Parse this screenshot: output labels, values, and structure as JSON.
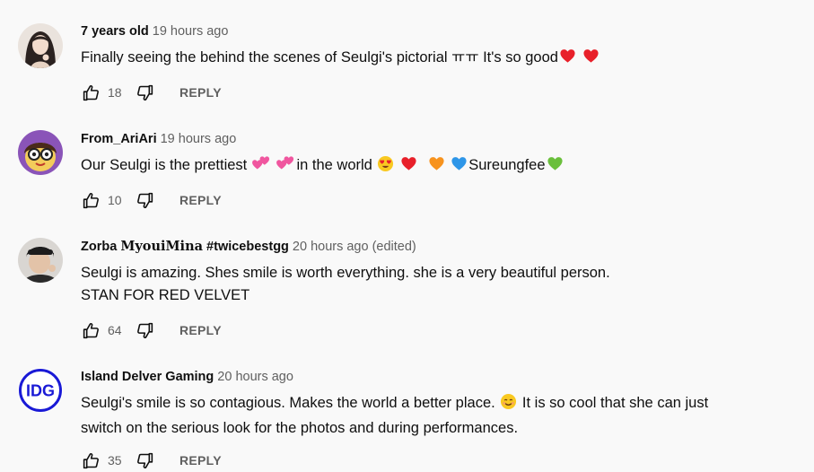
{
  "comments": [
    {
      "author": "7 years old",
      "time": "19 hours ago",
      "text_lines": [
        "Finally seeing the behind the scenes of Seulgi's pictorial ㅠㅠ It's so good"
      ],
      "emojis": [
        "red-heart",
        "red-heart"
      ],
      "likes": "18",
      "reply": "REPLY"
    },
    {
      "author": "From_AriAri",
      "time": "19 hours ago",
      "text_parts": [
        "Our Seulgi is the prettiest",
        "in the world",
        "Sureungfee"
      ],
      "emojis": [
        "two-hearts",
        "two-hearts",
        "heart-eyes",
        "red-heart",
        "orange-heart",
        "blue-heart",
        "green-heart"
      ],
      "likes": "10",
      "reply": "REPLY"
    },
    {
      "author_plain": "Zorba",
      "author_styled": "MyouiMina",
      "author_tag": "#twicebestgg",
      "time": "20 hours ago",
      "edited": "(edited)",
      "text_lines": [
        "Seulgi is amazing. Shes smile is worth everything. she is a very beautiful person.",
        "STAN FOR RED VELVET"
      ],
      "likes": "64",
      "reply": "REPLY"
    },
    {
      "author": "Island Delver Gaming",
      "time": "20 hours ago",
      "text_parts": [
        "Seulgi's smile is so contagious. Makes the world a better place.",
        "It is so cool that she can just",
        "switch on the serious look for the photos and during performances."
      ],
      "emojis": [
        "smiling-face"
      ],
      "avatar_text": "IDG",
      "likes": "35",
      "reply": "REPLY"
    }
  ],
  "colors": {
    "background": "#f9f9f9",
    "text": "#0f0f0f",
    "secondary": "#606060",
    "idg_blue": "#1a1ad6"
  }
}
